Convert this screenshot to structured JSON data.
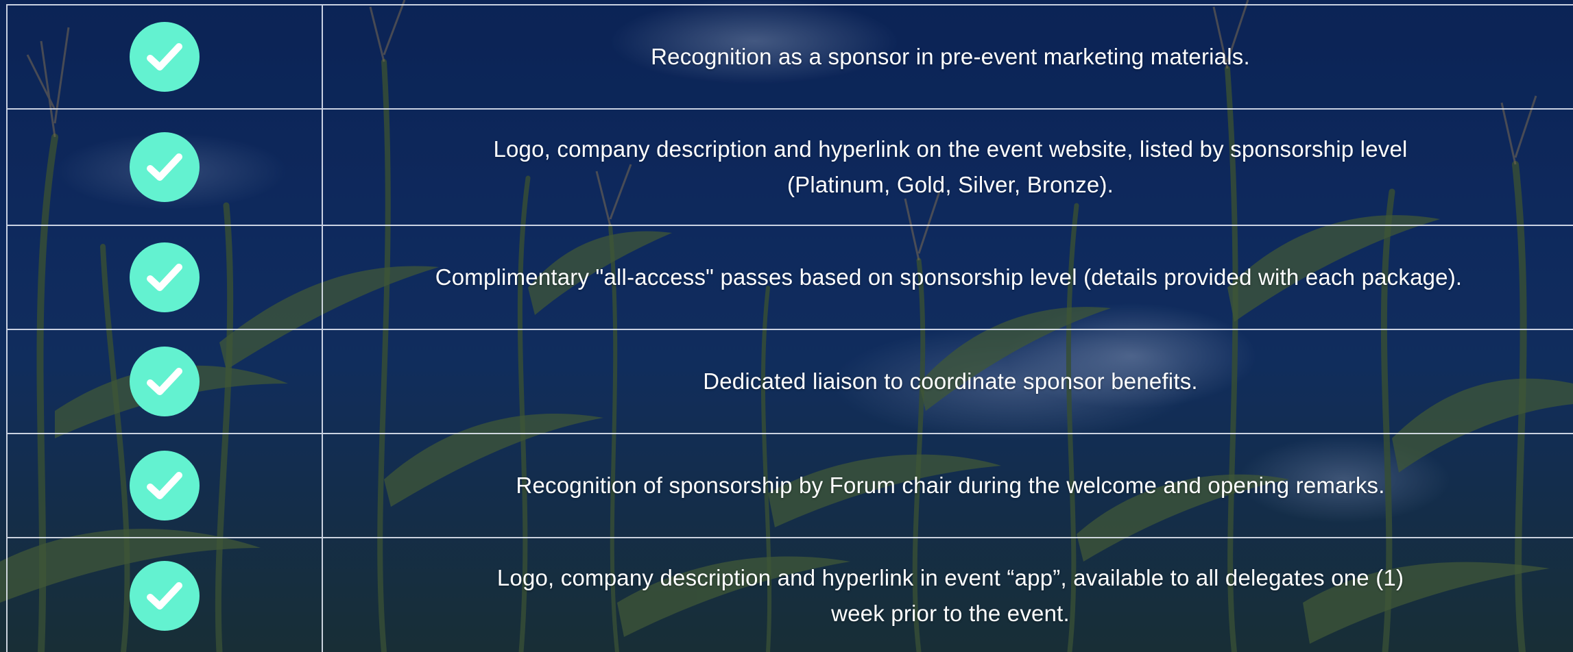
{
  "accent_color": "#63f2d0",
  "icon": "checkmark-icon",
  "benefits": [
    {
      "text": "Recognition as a sponsor in pre-event marketing materials."
    },
    {
      "text": "Logo, company description and hyperlink on the event website, listed by sponsorship level (Platinum, Gold, Silver, Bronze)."
    },
    {
      "text": "Complimentary \"all-access\" passes based on sponsorship level (details provided with each package)."
    },
    {
      "text": "Dedicated liaison to coordinate sponsor benefits."
    },
    {
      "text": "Recognition of sponsorship by Forum chair during the welcome and opening remarks."
    },
    {
      "text": "Logo, company description and hyperlink in event “app”, available to all delegates one (1) week prior to the event."
    }
  ]
}
